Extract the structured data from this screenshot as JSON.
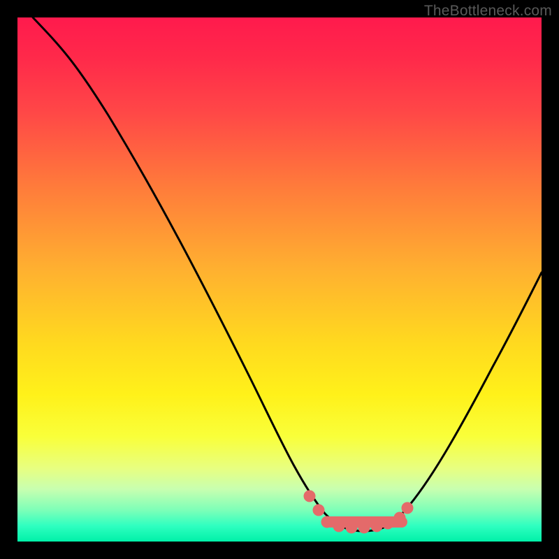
{
  "watermark": "TheBottleneck.com",
  "chart_data": {
    "type": "line",
    "title": "",
    "xlabel": "",
    "ylabel": "",
    "xlim": [
      0,
      100
    ],
    "ylim": [
      0,
      100
    ],
    "series": [
      {
        "name": "bottleneck-curve",
        "x": [
          3,
          6,
          12,
          20,
          30,
          40,
          48,
          53,
          56,
          60,
          64,
          68,
          71,
          74,
          78,
          84,
          90,
          96,
          100
        ],
        "values": [
          100,
          96,
          90,
          80,
          64,
          46,
          30,
          20,
          12,
          6,
          3,
          3,
          3,
          4,
          8,
          18,
          32,
          46,
          56
        ]
      },
      {
        "name": "highlight-band",
        "x": [
          56,
          58,
          60,
          62,
          64,
          66,
          68,
          70,
          72,
          74
        ],
        "values": [
          8,
          5,
          3,
          3,
          3,
          3,
          3,
          3,
          4,
          6
        ]
      }
    ],
    "colors": {
      "curve": "#000000",
      "highlight": "#e46a6a",
      "gradient_top": "#ff1a4d",
      "gradient_bottom": "#00f0a8"
    }
  }
}
